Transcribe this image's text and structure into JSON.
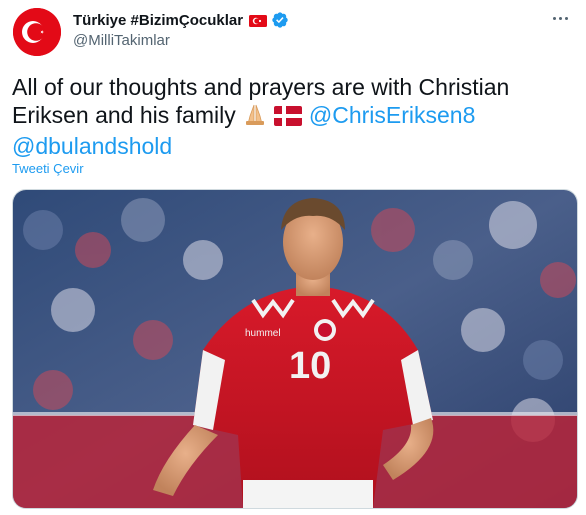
{
  "tweet": {
    "display_name": "Türkiye #BizimÇocuklar",
    "handle": "@MilliTakimlar",
    "text_main": "All of our thoughts and prayers are with Christian Eriksen and his family",
    "mentions": [
      "@ChrisEriksen8",
      "@dbulandshold"
    ],
    "translate_label": "Tweeti Çevir",
    "icons": {
      "more": "more-icon",
      "verified": "verified-badge-icon",
      "flag": "turkey-flag-icon",
      "emoji_1": "folded-hands-emoji",
      "emoji_2": "denmark-flag-emoji"
    }
  },
  "media": {
    "jersey_number": "10",
    "jersey_brand": "hummel"
  },
  "colors": {
    "accent": "#1d9bf0",
    "turkey_red": "#e30a17",
    "denmark_red": "#c8102e",
    "text": "#0f1419",
    "muted": "#536471"
  }
}
